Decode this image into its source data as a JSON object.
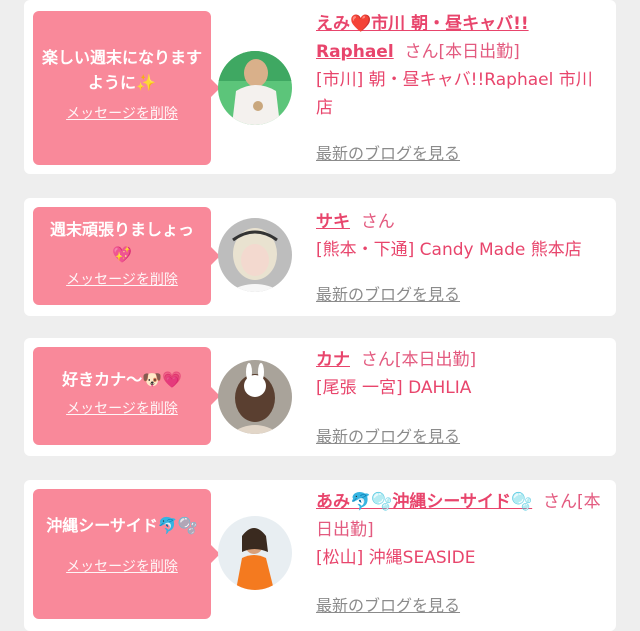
{
  "messages": [
    {
      "text": "楽しい週末になりますように✨",
      "delete_label": "メッセージを削除",
      "name": "えみ❤️市川 朝・昼キャバ!! Raphael",
      "honorific": "さん",
      "status": "[本日出勤]",
      "shop": "[市川] 朝・昼キャバ!!Raphael 市川店",
      "blog_label": "最新のブログを見る"
    },
    {
      "text": "週末頑張りましょっ💖",
      "delete_label": "メッセージを削除",
      "name": "サキ",
      "honorific": "さん",
      "status": "",
      "shop": "[熊本・下通] Candy Made 熊本店",
      "blog_label": "最新のブログを見る"
    },
    {
      "text": "好きカナ〜🐶💗",
      "delete_label": "メッセージを削除",
      "name": "カナ",
      "honorific": "さん",
      "status": "[本日出勤]",
      "shop": "[尾張 一宮] DAHLIA",
      "blog_label": "最新のブログを見る"
    },
    {
      "text": "沖縄シーサイド🐬🫧",
      "delete_label": "メッセージを削除",
      "name": "あみ🐬🫧沖縄シーサイド🫧",
      "honorific": "さん",
      "status": "[本日出勤]",
      "shop": "[松山] 沖縄SEASIDE",
      "blog_label": "最新のブログを見る"
    }
  ],
  "colors": {
    "background": "#eeeeee",
    "card": "#ffffff",
    "bubble": "#f9899a",
    "name": "#e8456c",
    "link_gray": "#8b8b8b"
  }
}
